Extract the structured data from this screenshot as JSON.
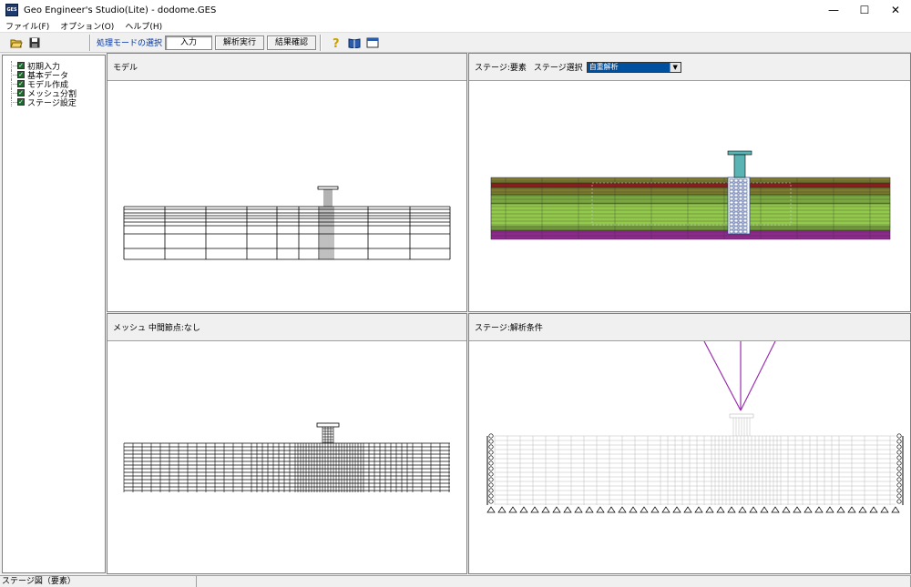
{
  "window": {
    "title": "Geo Engineer's Studio(Lite) - dodome.GES",
    "app_icon": "GES",
    "colors": {
      "accent": "#0050a0",
      "mode_label": "#0033a0"
    }
  },
  "menu": {
    "items": [
      "ファイル(F)",
      "オプション(O)",
      "ヘルプ(H)"
    ]
  },
  "toolbar": {
    "open_icon": "folder-open-icon",
    "save_icon": "save-disk-icon",
    "mode_label": "処理モードの選択",
    "mode_buttons": [
      "入力",
      "解析実行",
      "結果確認"
    ],
    "active_mode": "入力",
    "help_icon": "help-question-icon",
    "book_icon": "book-icon",
    "window_icon": "window-icon"
  },
  "tree": {
    "items": [
      "初期入力",
      "基本データ",
      "モデル作成",
      "メッシュ分割",
      "ステージ設定"
    ]
  },
  "panels": {
    "model": {
      "title": "モデル"
    },
    "stage_elements": {
      "label1": "ステージ:要素",
      "label2": "ステージ選択",
      "selected": "自重解析"
    },
    "mesh": {
      "title": "メッシュ 中間節点:なし"
    },
    "conditions": {
      "title": "ステージ:解析条件"
    }
  },
  "layer_colors": [
    "#7c7a2e",
    "#8c1e1e",
    "#7aa83e",
    "#93c94b",
    "#8c2a8c"
  ],
  "status": {
    "text": "ステージ図（要素）"
  }
}
